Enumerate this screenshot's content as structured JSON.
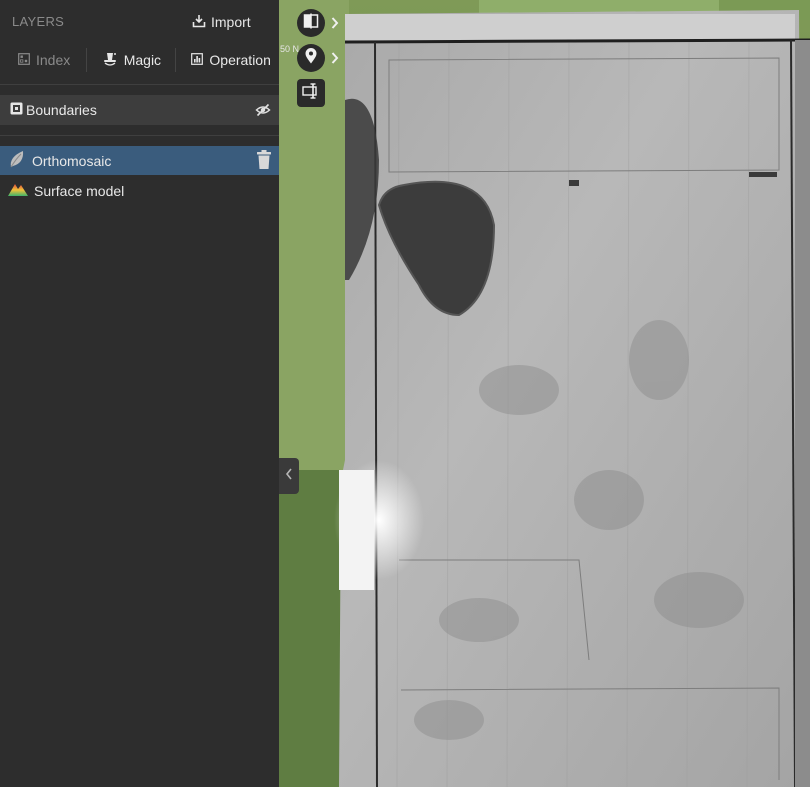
{
  "sidebar": {
    "title": "LAYERS",
    "import_label": "Import",
    "tools": {
      "index_label": "Index",
      "magic_label": "Magic",
      "operation_label": "Operation"
    },
    "boundaries_label": "Boundaries",
    "layers": [
      {
        "label": "Orthomosaic",
        "selected": true
      },
      {
        "label": "Surface model",
        "selected": false
      }
    ]
  },
  "map": {
    "scale_text": "50 N"
  },
  "colors": {
    "sidebar_bg": "#2d2d2d",
    "selected_row": "#3a5c7d",
    "boundaries_row": "#3d3d3d",
    "field_green": "#6f8a4e"
  },
  "icons": {
    "import": "download-icon",
    "index": "index-grid-icon",
    "magic": "magic-hat-icon",
    "operation": "operation-chart-icon",
    "boundaries": "boundaries-square-icon",
    "visibility": "eye-off-icon",
    "orthomosaic": "leaf-icon",
    "surface_model": "mountain-icon",
    "delete": "trash-icon"
  }
}
